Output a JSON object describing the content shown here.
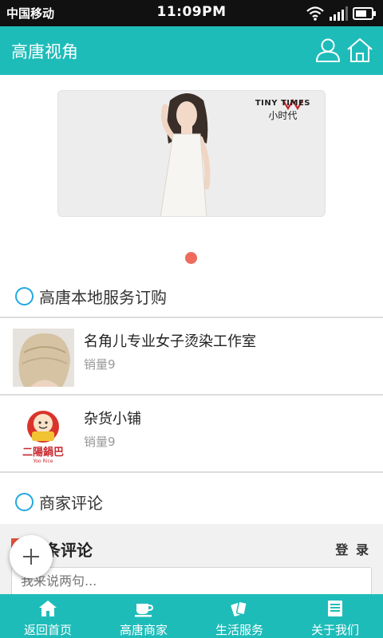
{
  "status_bar": {
    "carrier": "中国移动",
    "time": "11:09PM",
    "icons": [
      "wifi-icon",
      "signal-icon",
      "battery-icon"
    ]
  },
  "app_bar": {
    "title": "高唐视角",
    "icons": [
      "user-icon",
      "home-icon"
    ],
    "color": "#1ebcb9"
  },
  "banner": {
    "brand_en": "TINY TIMES",
    "brand_cn": "小时代",
    "pager_active_color": "#ee6b5d"
  },
  "sections": {
    "local_services": "高唐本地服务订购",
    "merchant_reviews": "商家评论"
  },
  "items": [
    {
      "name": "名角儿专业女子烫染工作室",
      "sales": "销量9",
      "thumb_icon": "hair-photo"
    },
    {
      "name": "杂货小铺",
      "sales": "销量9",
      "thumb_icon": "rice-shop-logo",
      "logo_text": "二陽鍋巴",
      "logo_sub": "Yoo Rice"
    }
  ],
  "comments": {
    "title": "条评论",
    "login": "登 录",
    "placeholder": "我来说两句..."
  },
  "tabs": [
    {
      "label": "返回首页",
      "icon": "home-icon"
    },
    {
      "label": "高唐商家",
      "icon": "coffee-cup-icon"
    },
    {
      "label": "生活服务",
      "icon": "cards-icon"
    },
    {
      "label": "关于我们",
      "icon": "document-icon"
    }
  ]
}
